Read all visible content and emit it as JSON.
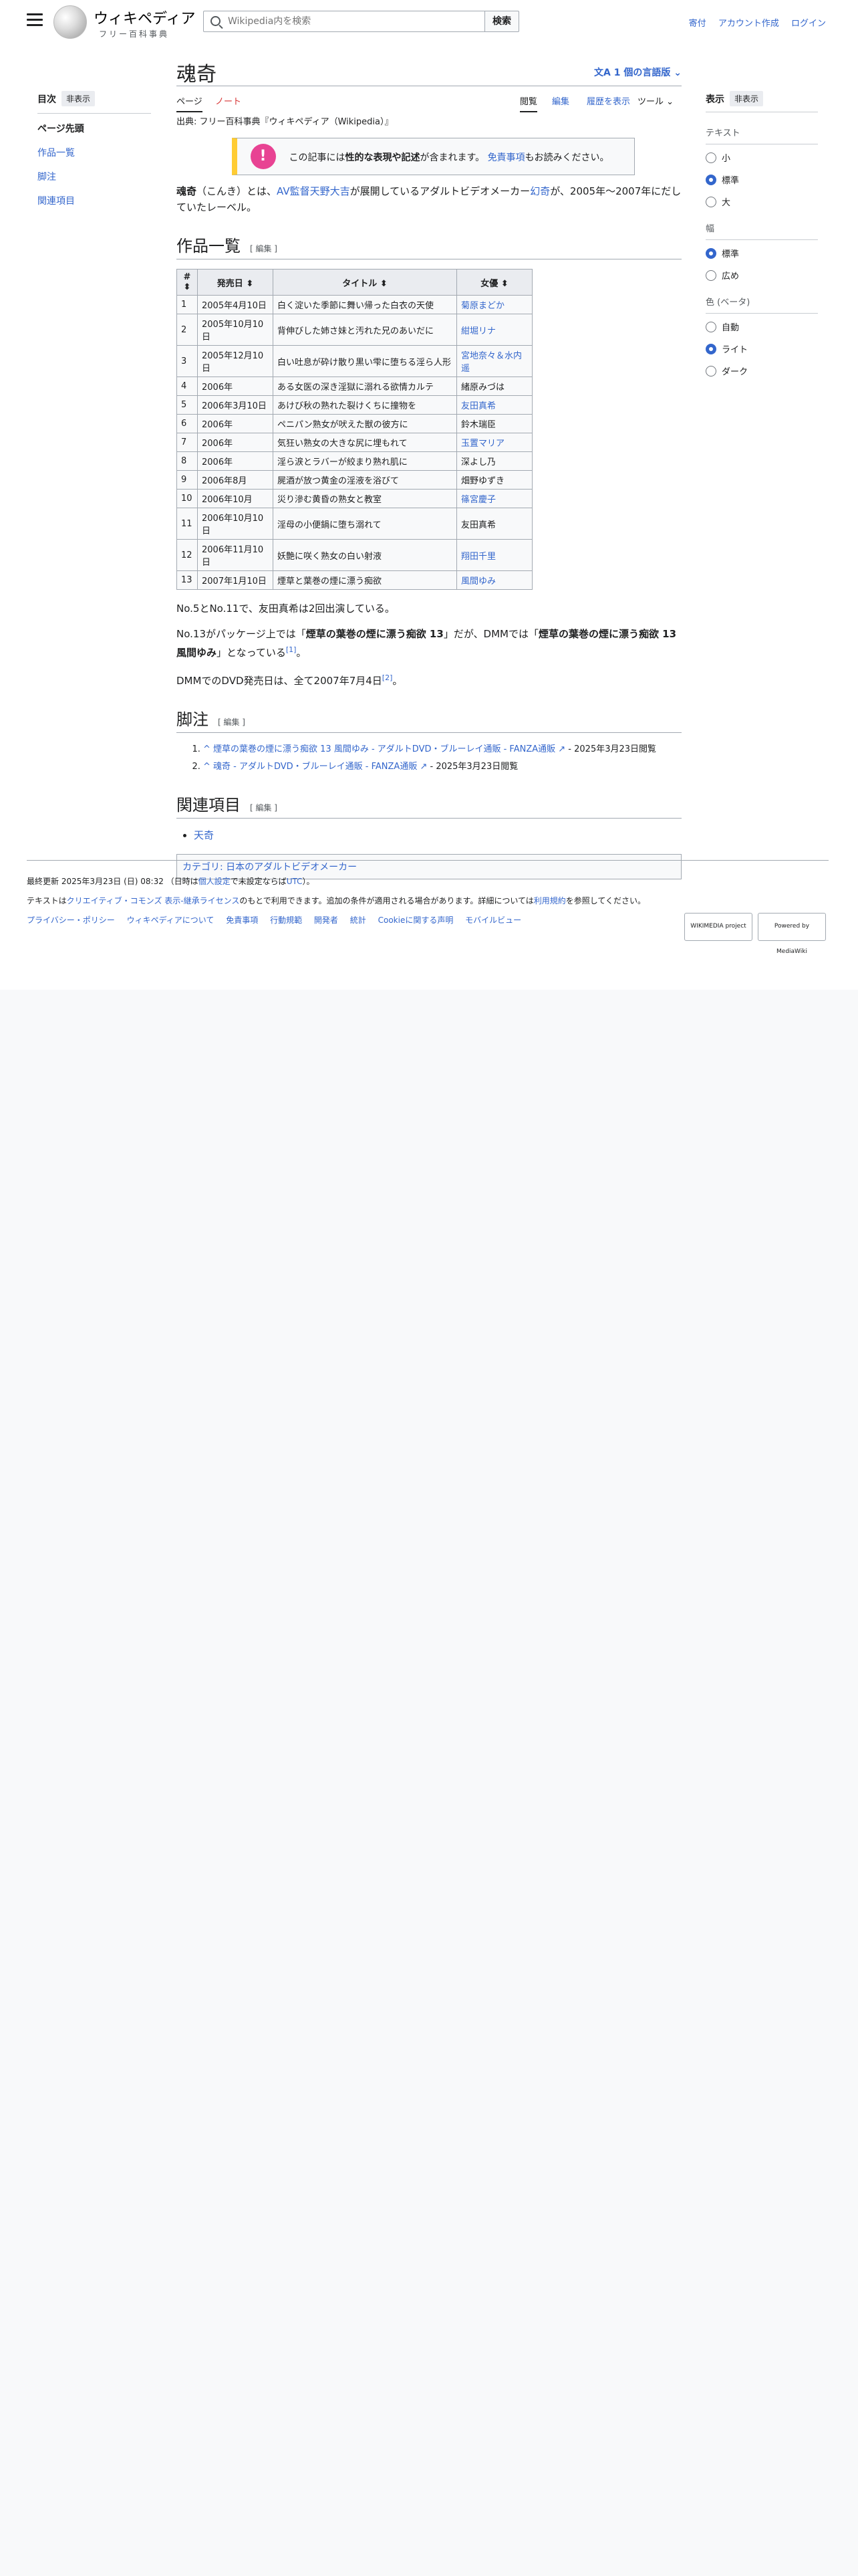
{
  "header": {
    "wordmark_title": "ウィキペディア",
    "wordmark_tagline": "フリー百科事典",
    "search_placeholder": "Wikipedia内を検索",
    "search_button": "検索",
    "links": [
      "寄付",
      "アカウント作成",
      "ログイン"
    ]
  },
  "toc": {
    "title": "目次",
    "hide": "非表示",
    "items": [
      "ページ先頭",
      "作品一覧",
      "脚注",
      "関連項目"
    ]
  },
  "appearance": {
    "title": "表示",
    "hide": "非表示",
    "text_title": "テキスト",
    "text_options": [
      "小",
      "標準",
      "大"
    ],
    "width_title": "幅",
    "width_options": [
      "標準",
      "広め"
    ],
    "color_title": "色 (ベータ)",
    "color_options": [
      "自動",
      "ライト",
      "ダーク"
    ]
  },
  "article": {
    "title": "魂奇",
    "languages": "1 個の言語版",
    "tabs": {
      "page": "ページ",
      "talk": "ノート",
      "read": "閲覧",
      "edit": "編集",
      "history": "履歴を表示",
      "tools": "ツール"
    },
    "from": "出典: フリー百科事典『ウィキペディア（Wikipedia）』",
    "notice_icon": "!",
    "notice_pre": "この記事には",
    "notice_bold": "性的な表現や記述",
    "notice_mid": "が含まれます。",
    "notice_link": "免責事項",
    "notice_post": "もお読みください。",
    "intro_bold": "魂奇",
    "intro_1": "（こんき）とは、",
    "intro_link1": "AV監督",
    "intro_link2": "天野大吉",
    "intro_2": "が展開しているアダルトビデオメーカー",
    "intro_link3": "幻奇",
    "intro_3": "が、2005年〜2007年にだしていたレーベル。",
    "section_works": "作品一覧",
    "edit_label": "[ 編集 ]",
    "table_headers": [
      "#",
      "発売日",
      "タイトル",
      "女優"
    ],
    "rows": [
      {
        "n": "1",
        "date": "2005年4月10日",
        "title": "白く淀いた季節に舞い帰った白衣の天使",
        "actress": "菊原まどか",
        "link": true
      },
      {
        "n": "2",
        "date": "2005年10月10日",
        "title": "背伸びした姉さ妹と汚れた兄のあいだに",
        "actress": "紺堀リナ",
        "link": true
      },
      {
        "n": "3",
        "date": "2005年12月10日",
        "title": "白い吐息が砕け散り黒い雫に堕ちる淫ら人形",
        "actress": "宮地奈々＆水内遥",
        "link": true
      },
      {
        "n": "4",
        "date": "2006年",
        "title": "ある女医の深き淫獄に溺れる欲情カルテ",
        "actress": "緒原みづは",
        "link": false
      },
      {
        "n": "5",
        "date": "2006年3月10日",
        "title": "あけび秋の熟れた裂けくちに撞物を",
        "actress": "友田真希",
        "link": true
      },
      {
        "n": "6",
        "date": "2006年",
        "title": "ペニパン熟女が吠えた獣の彼方に",
        "actress": "鈴木瑞臣",
        "link": false
      },
      {
        "n": "7",
        "date": "2006年",
        "title": "気狂い熟女の大きな尻に埋もれて",
        "actress": "玉置マリア",
        "link": true
      },
      {
        "n": "8",
        "date": "2006年",
        "title": "淫ら涙とラバーが絞まり熟れ肌に",
        "actress": "深よし乃",
        "link": false
      },
      {
        "n": "9",
        "date": "2006年8月",
        "title": "屍酒が放つ黄金の淫液を浴びて",
        "actress": "畑野ゆずき",
        "link": false
      },
      {
        "n": "10",
        "date": "2006年10月",
        "title": "災り滲む黄昏の熟女と教室",
        "actress": "篠宮慶子",
        "link": true
      },
      {
        "n": "11",
        "date": "2006年10月10日",
        "title": "淫母の小便鍋に堕ち溺れて",
        "actress": "友田真希",
        "link": false
      },
      {
        "n": "12",
        "date": "2006年11月10日",
        "title": "妖艶に咲く熟女の白い射液",
        "actress": "翔田千里",
        "link": true
      },
      {
        "n": "13",
        "date": "2007年1月10日",
        "title": "煙草と葉巻の煙に漂う痴欲",
        "actress": "風間ゆみ",
        "link": true
      }
    ],
    "para1": "No.5とNo.11で、友田真希は2回出演している。",
    "para2_a": "No.13がパッケージ上では「",
    "para2_b": "煙草の葉巻の煙に漂う痴欲 13",
    "para2_c": "」だが、DMMでは「",
    "para2_d": "煙草の葉巻の煙に漂う痴欲 13 風間ゆみ",
    "para2_e": "」となっている",
    "ref1": "[1]",
    "para3": "DMMでのDVD発売日は、全て2007年7月4日",
    "ref2": "[2]",
    "para3_end": "。",
    "section_notes": "脚注",
    "note1_link": "煙草の葉巻の煙に漂う痴欲 13 風間ゆみ - アダルトDVD・ブルーレイ通販 - FANZA通販",
    "note1_rest": " - 2025年3月23日閲覧",
    "note2_link": "魂奇 - アダルトDVD・ブルーレイ通販 - FANZA通販",
    "note2_rest": " - 2025年3月23日閲覧",
    "section_related": "関連項目",
    "related": [
      "天奇"
    ],
    "category": "カテゴリ: 日本のアダルトビデオメーカー"
  },
  "footer": {
    "last_edit_1": "最終更新 2025年3月23日 (日) 08:32 （日時は",
    "last_edit_link": "個人設定",
    "last_edit_2": "で未設定ならば",
    "last_edit_link2": "UTC",
    "last_edit_3": "）。",
    "license_1": "テキストは",
    "license_link": "クリエイティブ・コモンズ 表示-継承ライセンス",
    "license_2": "のもとで利用できます。追加の条件が適用される場合があります。詳細については",
    "license_link2": "利用規約",
    "license_3": "を参照してください。",
    "links": [
      "プライバシー・ポリシー",
      "ウィキペディアについて",
      "免責事項",
      "行動規範",
      "開発者",
      "統計",
      "Cookieに関する声明",
      "モバイルビュー"
    ],
    "badge1": "WIKIMEDIA project",
    "badge2": "Powered by MediaWiki"
  }
}
